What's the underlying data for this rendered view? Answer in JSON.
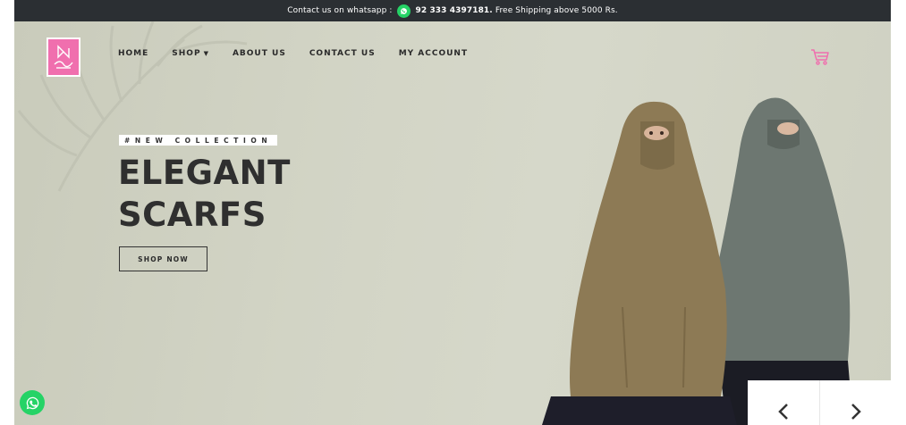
{
  "topbar": {
    "contact_text": "Contact us on whatsapp :",
    "phone": "92 333 4397181.",
    "shipping_text": "Free Shipping above 5000 Rs."
  },
  "nav": {
    "items": [
      {
        "label": "HOME"
      },
      {
        "label": "SHOP"
      },
      {
        "label": "ABOUT US"
      },
      {
        "label": "CONTACT US"
      },
      {
        "label": "MY ACCOUNT"
      }
    ]
  },
  "hero": {
    "eyebrow": "#NEW COLLECTION",
    "headline_line1": "ELEGANT",
    "headline_line2": "SCARFS",
    "cta_label": "SHOP NOW"
  },
  "icons": {
    "cart": "cart-icon",
    "whatsapp": "whatsapp-icon",
    "prev": "chevron-left-icon",
    "next": "chevron-right-icon"
  },
  "colors": {
    "topbar_bg": "#2b2f33",
    "brand_pink": "#f06fae",
    "whatsapp_green": "#25d366",
    "hero_bg": "#d2d4c5",
    "headline": "#2f2f2f"
  }
}
